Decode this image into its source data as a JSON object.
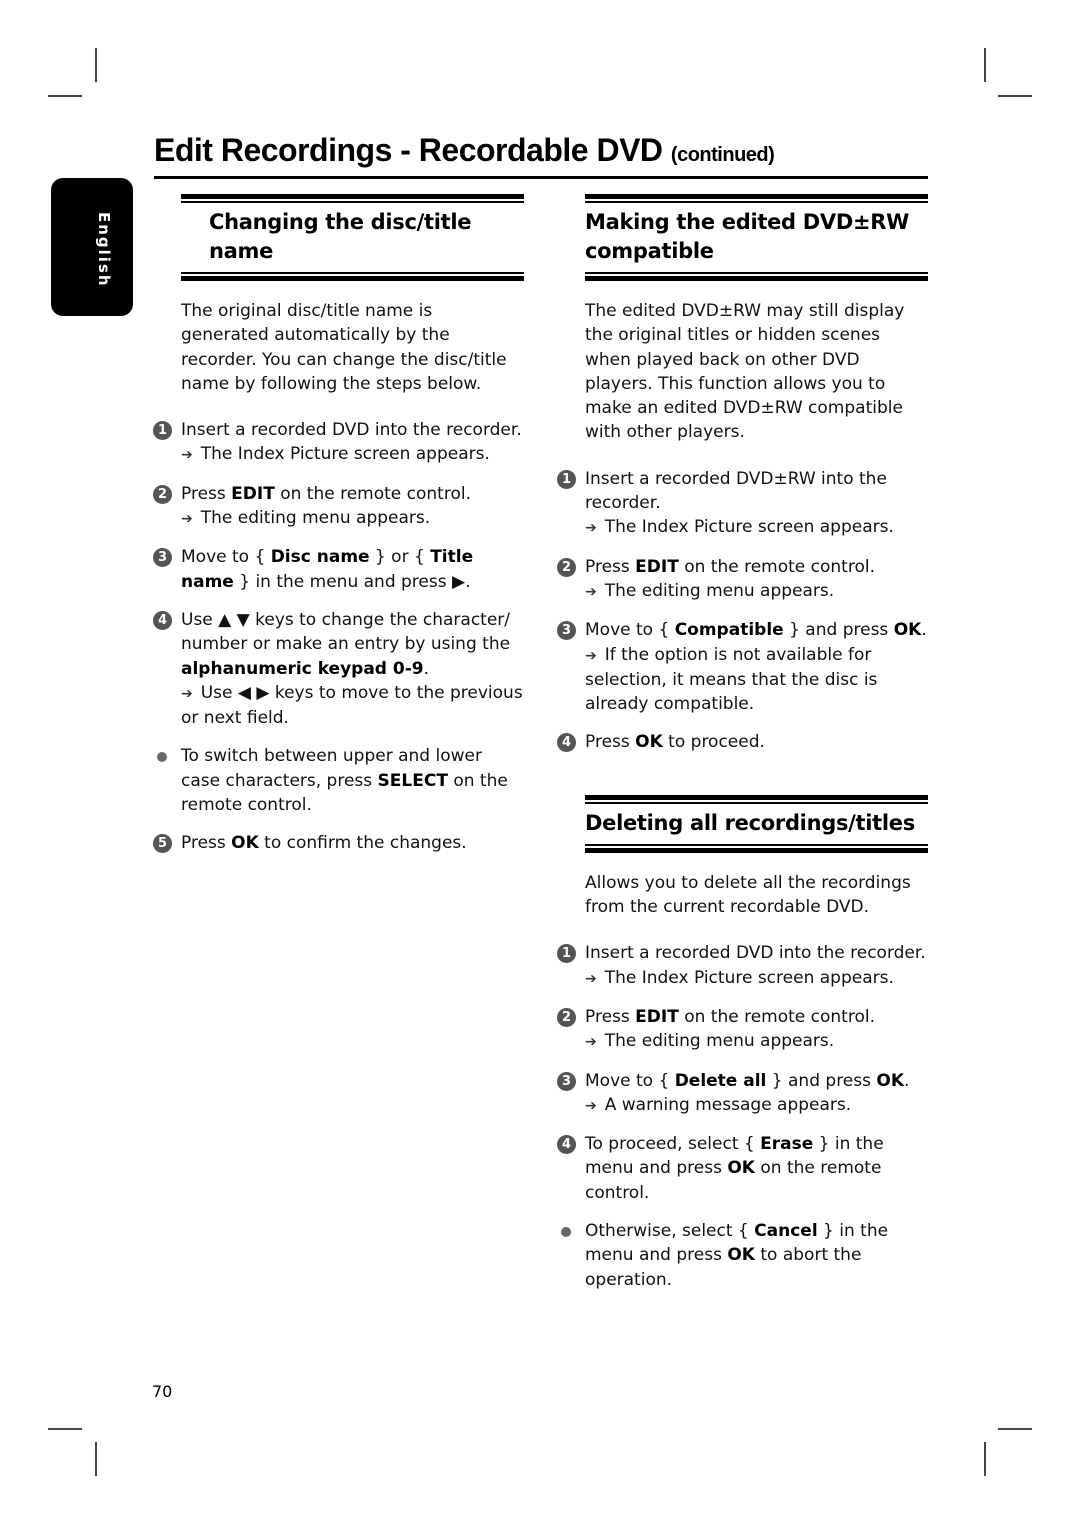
{
  "page": {
    "title": "Edit Recordings - Recordable DVD",
    "title_suffix": "(continued)",
    "language_tab": "English",
    "page_number": "70"
  },
  "icons": {
    "result_arrow": "➔",
    "bullet": "•"
  },
  "sections": {
    "disc_name": {
      "heading": "Changing the disc/title name",
      "intro": "The original disc/title name is generated automatically by the recorder. You can change the disc/title name by following the steps below.",
      "steps": [
        {
          "badge": "1",
          "text_parts": [
            "Insert a recorded DVD into the recorder."
          ],
          "result": "The Index Picture screen appears."
        },
        {
          "badge": "2",
          "pre": "Press ",
          "bold": "EDIT",
          "post": " on the remote control.",
          "result": "The editing menu appears."
        },
        {
          "badge": "3",
          "pre": "Move to { ",
          "bold": "Disc name",
          "mid": " } or { ",
          "bold2": "Title name",
          "post": " } in the menu and press ▶."
        },
        {
          "badge": "4",
          "pre": "Use ▲ ▼ keys to change the character/ number or make an entry by using the ",
          "bold": "alphanumeric keypad 0-9",
          "post": ".",
          "result": "Use ◀ ▶ keys to move to the previous or next field."
        },
        {
          "badge": "•",
          "pre": "To switch between upper and lower case characters, press ",
          "bold": "SELECT",
          "post": " on the remote control."
        },
        {
          "badge": "5",
          "pre": "Press ",
          "bold": "OK",
          "post": " to confirm the changes."
        }
      ]
    },
    "compatible": {
      "heading": "Making the edited DVD±RW compatible",
      "intro": "The edited DVD±RW may still display the original titles or hidden scenes when played back on other DVD players. This function allows you to make an edited DVD±RW compatible with other players.",
      "steps": [
        {
          "badge": "1",
          "text": "Insert a recorded DVD±RW into the recorder.",
          "result": "The Index Picture screen appears."
        },
        {
          "badge": "2",
          "pre": "Press ",
          "bold": "EDIT",
          "post": " on the remote control.",
          "result": "The editing menu appears."
        },
        {
          "badge": "3",
          "pre": "Move to { ",
          "bold": "Compatible",
          "mid": " } and press ",
          "bold2": "OK",
          "post": ".",
          "result": "If the option is not available for selection, it means that the disc is already compatible."
        },
        {
          "badge": "4",
          "pre": "Press ",
          "bold": "OK",
          "post": " to proceed."
        }
      ]
    },
    "delete_all": {
      "heading": "Deleting all recordings/titles",
      "intro": "Allows you to delete all the recordings from the current recordable DVD.",
      "steps": [
        {
          "badge": "1",
          "text": "Insert a recorded DVD into the recorder.",
          "result": "The Index Picture screen appears."
        },
        {
          "badge": "2",
          "pre": "Press ",
          "bold": "EDIT",
          "post": " on the remote control.",
          "result": "The editing menu appears."
        },
        {
          "badge": "3",
          "pre": "Move to { ",
          "bold": "Delete all",
          "mid": " } and press ",
          "bold2": "OK",
          "post": ".",
          "result": "A warning message appears."
        },
        {
          "badge": "4",
          "pre": "To proceed, select { ",
          "bold": "Erase",
          "mid": " } in the menu and press ",
          "bold2": "OK",
          "post": " on the remote control."
        },
        {
          "badge": "•",
          "pre": "Otherwise, select { ",
          "bold": "Cancel",
          "mid": " } in the menu and press ",
          "bold2": "OK",
          "post": " to abort the operation."
        }
      ]
    }
  }
}
